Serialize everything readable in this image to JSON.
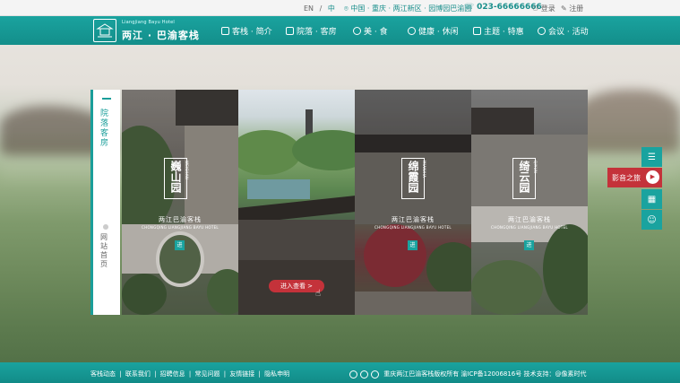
{
  "topbar": {
    "lang_en": "EN",
    "lang_sep": "/",
    "lang_zh": "中",
    "location": "中国 · 重庆 · 两江新区 · 园博园巴渝园",
    "phone": "023-66666666",
    "login": "登录",
    "register": "注册"
  },
  "brand": {
    "subtitle": "Liangjiang Bayu Hotel",
    "name": "两江 · 巴渝客栈"
  },
  "nav": [
    {
      "label": "客栈 · 简介",
      "icon": "home-icon"
    },
    {
      "label": "院落 · 客房",
      "icon": "building-icon"
    },
    {
      "label": "美  · 食",
      "icon": "food-icon"
    },
    {
      "label": "健康 · 休闲",
      "icon": "leaf-icon"
    },
    {
      "label": "主题 · 特惠",
      "icon": "book-icon"
    },
    {
      "label": "会议 · 活动",
      "icon": "chat-icon"
    }
  ],
  "side": {
    "active_label": "院落客房",
    "label": "网站首页"
  },
  "panels": [
    {
      "name": "巍山园",
      "name_en": "WEISHAN",
      "hotel": "两江巴渝客栈",
      "hotel_en": "CHONGQING LIANGJIANG BAYU HOTEL",
      "go": "进"
    },
    {
      "enter": "进入查看 >"
    },
    {
      "name": "绵霞园",
      "name_en": "MIANXIA",
      "hotel": "两江巴渝客栈",
      "hotel_en": "CHONGQING LIANGJIANG BAYU HOTEL",
      "go": "进"
    },
    {
      "name": "绮云园",
      "name_en": "QIYUN",
      "hotel": "两江巴渝客栈",
      "hotel_en": "CHONGQING LIANGJIANG BAYU HOTEL",
      "go": "进"
    }
  ],
  "float": {
    "video": "影音之旅"
  },
  "footer": {
    "links": [
      "客栈动态",
      "联系我们",
      "招聘信息",
      "常见问题",
      "友情链接",
      "隐私申明"
    ],
    "sep": "|",
    "copyright": "重庆两江巴渝客栈版权所有  渝ICP备12006816号  技术支持：@像素时代"
  },
  "colors": {
    "accent": "#1aa39f",
    "highlight": "#c4323a"
  }
}
